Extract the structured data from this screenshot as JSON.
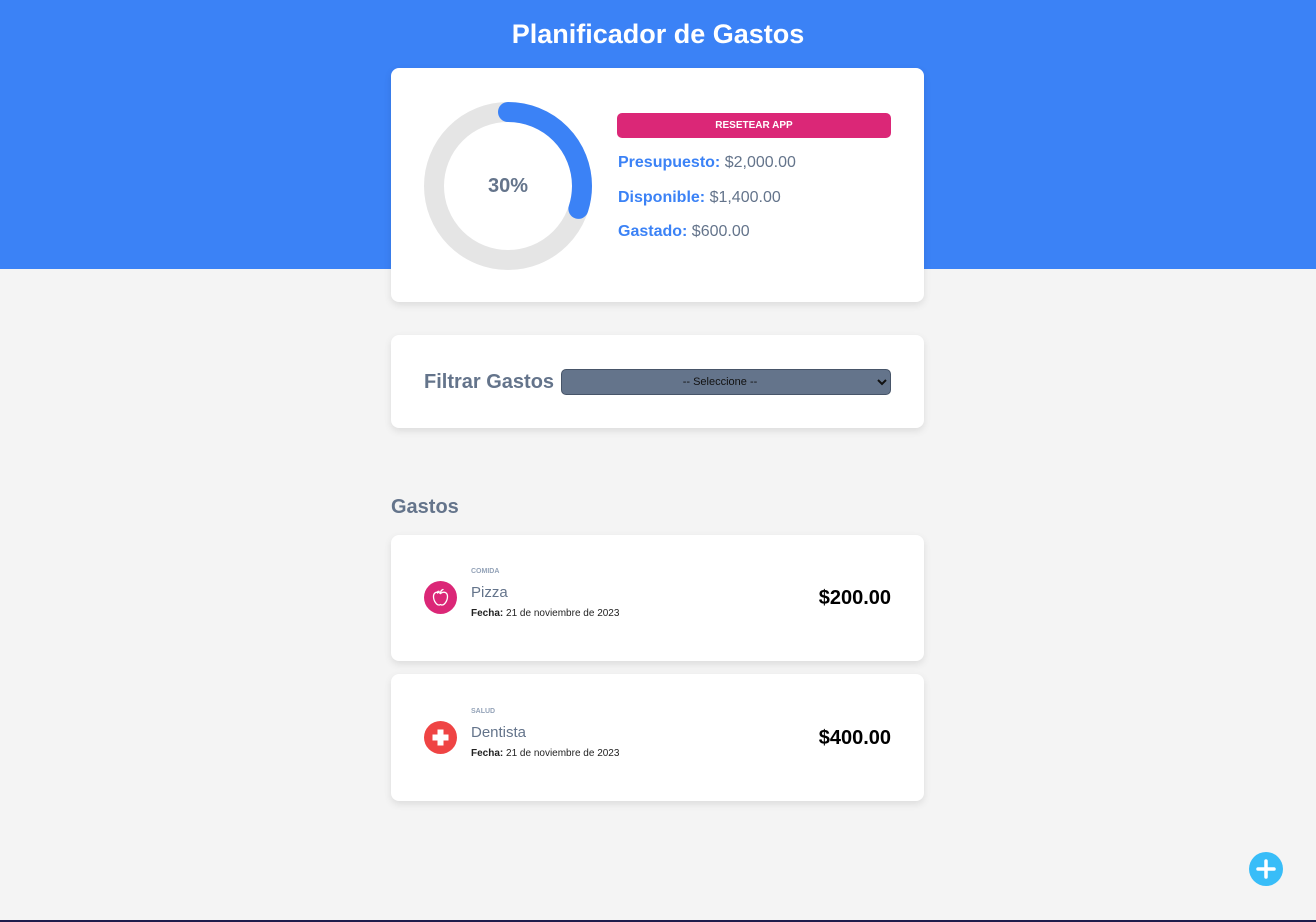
{
  "header": {
    "title": "Planificador de Gastos",
    "background_color": "#3b82f6"
  },
  "budget": {
    "percent_label": "30%",
    "percent_value": 30,
    "ring_color": "#3b82f6",
    "ring_track_color": "#e5e5e5",
    "reset_label": "Resetear App",
    "reset_color": "#db2777",
    "stats": [
      {
        "label": "Presupuesto:",
        "value": "$2,000.00"
      },
      {
        "label": "Disponible:",
        "value": "$1,400.00"
      },
      {
        "label": "Gastado:",
        "value": "$600.00"
      }
    ]
  },
  "filter": {
    "label": "Filtrar Gastos",
    "selected_option": "-- Seleccione --"
  },
  "expenses": {
    "title": "Gastos",
    "items": [
      {
        "category": "Comida",
        "name": "Pizza",
        "date_label": "Fecha:",
        "date": "21 de noviembre de 2023",
        "amount": "$200.00",
        "icon": "apple-icon",
        "icon_color": "#db2777"
      },
      {
        "category": "Salud",
        "name": "Dentista",
        "date_label": "Fecha:",
        "date": "21 de noviembre de 2023",
        "amount": "$400.00",
        "icon": "health-cross-icon",
        "icon_color": "#ef4444"
      }
    ]
  },
  "fab": {
    "icon": "plus-icon",
    "color": "#38bdf8"
  }
}
